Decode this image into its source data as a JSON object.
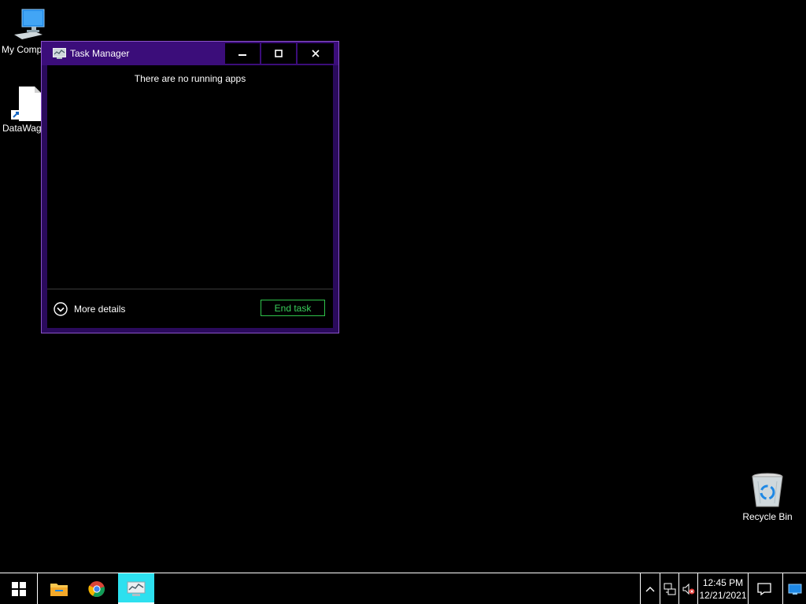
{
  "desktop": {
    "icons": [
      {
        "label": "My Comp"
      },
      {
        "label": "DataWag"
      },
      {
        "label": "Recycle Bin"
      }
    ]
  },
  "task_manager": {
    "title": "Task Manager",
    "empty_message": "There are no running apps",
    "more_details_label": "More details",
    "end_task_label": "End task",
    "colors": {
      "titlebar": "#3b0d7a",
      "frame": "#2a0a5c",
      "end_task_border": "#2ec44a"
    }
  },
  "taskbar": {
    "items": [
      {
        "icon": "windows-start-icon"
      },
      {
        "icon": "file-explorer-icon"
      },
      {
        "icon": "chrome-icon"
      },
      {
        "icon": "task-manager-icon",
        "active": true
      }
    ],
    "tray": {
      "time": "12:45 PM",
      "date": "12/21/2021",
      "icons": [
        "chevron-up-icon",
        "network-icon",
        "volume-muted-icon",
        "action-center-icon",
        "show-desktop-icon"
      ]
    }
  }
}
